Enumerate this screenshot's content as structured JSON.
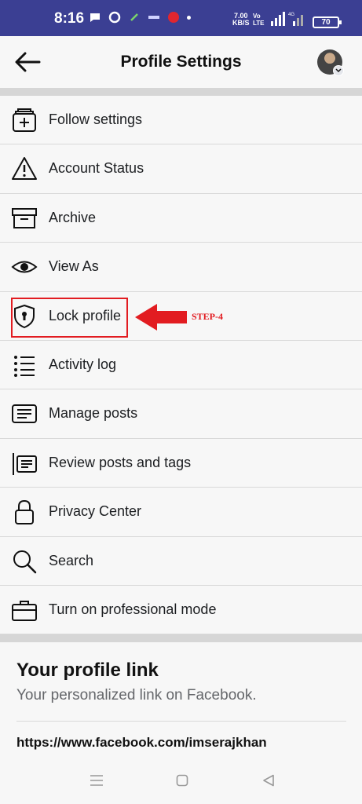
{
  "status_bar": {
    "time": "8:16",
    "speed_value": "7.00",
    "speed_unit": "KB/S",
    "volte_top": "Vo",
    "volte_mid": "LTE",
    "volte_bot": "LTE1",
    "network": "4G",
    "battery": "70"
  },
  "header": {
    "title": "Profile Settings"
  },
  "menu": {
    "items": [
      {
        "label": "Follow settings",
        "icon": "follow-settings-icon"
      },
      {
        "label": "Account Status",
        "icon": "warning-icon"
      },
      {
        "label": "Archive",
        "icon": "archive-icon"
      },
      {
        "label": "View As",
        "icon": "eye-icon"
      },
      {
        "label": "Lock profile",
        "icon": "shield-lock-icon"
      },
      {
        "label": "Activity log",
        "icon": "list-icon"
      },
      {
        "label": "Manage posts",
        "icon": "posts-icon"
      },
      {
        "label": "Review posts and tags",
        "icon": "review-posts-icon"
      },
      {
        "label": "Privacy Center",
        "icon": "lock-icon"
      },
      {
        "label": "Search",
        "icon": "search-icon"
      },
      {
        "label": "Turn on professional mode",
        "icon": "briefcase-icon"
      }
    ]
  },
  "annotation": {
    "step_label": "STEP-4",
    "color": "#e21c21"
  },
  "profile_link": {
    "title": "Your profile link",
    "subtitle": "Your personalized link on Facebook.",
    "url": "https://www.facebook.com/imserajkhan"
  },
  "colors": {
    "status_bar": "#3b3f93",
    "background": "#f7f7f7",
    "divider": "#d6d6d6"
  }
}
